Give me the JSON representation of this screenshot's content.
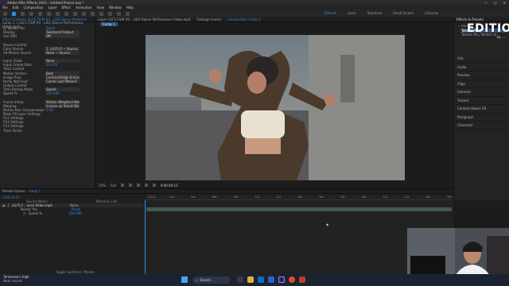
{
  "window": {
    "title": "Adobe After Effects 2023 - Untitled Project.aep *",
    "controls": [
      "—",
      "□",
      "✕"
    ]
  },
  "menu": [
    "File",
    "Edit",
    "Composition",
    "Layer",
    "Effect",
    "Animation",
    "View",
    "Window",
    "Help"
  ],
  "workspaces": [
    "Default",
    "Learn",
    "Standard",
    "Small Screen",
    "Libraries"
  ],
  "active_workspace": "Default",
  "effect_panel": {
    "tab": "Effect Controls: LILI'S FILM #2 - LISA Dance Performa",
    "header": "Comp 1 • LILI'S FILM #2 - LISA Dance Performance Video.mp4",
    "props": [
      {
        "name": "fx Twixtor Pro",
        "value": "Reset",
        "style": "blue"
      },
      {
        "name": "Display",
        "value": "Twixtored Output"
      },
      {
        "name": "Use GPU",
        "value": "Off"
      },
      {
        "name": "",
        "value": "",
        "style": "none"
      },
      {
        "name": "Source Control",
        "value": "",
        "style": "none"
      },
      {
        "name": "Color Source",
        "value": "1. LILI'S Fi ~  Source"
      },
      {
        "name": "Alt Motion Source",
        "value": "None ~  Source"
      },
      {
        "name": "",
        "value": "",
        "style": "none"
      },
      {
        "name": "Input: Fields",
        "value": "None"
      },
      {
        "name": "Input: Frame Rate",
        "value": "23.976",
        "style": "blue"
      },
      {
        "name": "Track Control",
        "value": "",
        "style": "none"
      },
      {
        "name": "Motion Vectors",
        "value": "Best"
      },
      {
        "name": "Image Prep",
        "value": "Contrast/Edge Enhance"
      },
      {
        "name": "Parity Warning?",
        "value": "Cache Last Motion?"
      },
      {
        "name": "Output Control",
        "value": "",
        "style": "none"
      },
      {
        "name": "Time Remap Mode",
        "value": "Speed"
      },
      {
        "name": "Speed %",
        "value": "100.000",
        "style": "blue"
      },
      {
        "name": "",
        "value": "",
        "style": "none"
      },
      {
        "name": "Frame Interp",
        "value": "Motion Weighted Blend"
      },
      {
        "name": "Warping",
        "value": "Inverse w/ Smart Blend"
      },
      {
        "name": "Motion Blur Compensation",
        "value": "0.00",
        "style": "blue"
      },
      {
        "name": "Mask Fill Layer Settings",
        "value": "",
        "style": "none"
      },
      {
        "name": "FG1 Settings",
        "value": "",
        "style": "none"
      },
      {
        "name": "FG2 Settings",
        "value": "",
        "style": "none"
      },
      {
        "name": "FG3 Settings",
        "value": "",
        "style": "none"
      },
      {
        "name": "Track Points",
        "value": "",
        "style": "none"
      }
    ]
  },
  "viewer": {
    "tabs": [
      "Layer  LILI'S FILM #2 - LISA Dance Performance Video.mp4",
      "Footage  (none)",
      "Composition  Comp 1"
    ],
    "subtab": "Comp 1",
    "zoom": "25%",
    "quality": "Full",
    "timecode": "0:00:04:15"
  },
  "right_panel": {
    "title": "Effects & Presets",
    "search": "twixtor",
    "results": [
      "Twixtor Pro",
      "Twixtor Pro, Vectors In"
    ],
    "items": [
      "Info",
      "Audio",
      "Preview",
      "Align",
      "Libraries",
      "Tracker",
      "Content-Aware Fill",
      "Paragraph",
      "Character"
    ]
  },
  "timeline": {
    "panel_tabs": [
      "Render Queue",
      "Comp 1"
    ],
    "timecode": "0:00:04:15",
    "columns": [
      "Source Name",
      "Parent & Link"
    ],
    "layers": [
      {
        "index": "1",
        "name": "LILI'S F... ance Video.mp4",
        "parent": "None"
      },
      {
        "index": "",
        "name": "Twixtor Pro",
        "parent": ""
      },
      {
        "index": "",
        "name": "Speed %",
        "parent": "100.000"
      }
    ],
    "ruler": [
      "0:00s",
      "02s",
      "04s",
      "06s",
      "08s",
      "10s",
      "12s",
      "14s",
      "16s",
      "18s",
      "20s",
      "22s",
      "24s",
      "26s",
      "28s"
    ],
    "reset": "Reset",
    "footer": "Toggle Switches / Modes"
  },
  "taskbar": {
    "notification": "Tomorrow's high",
    "notification_sub": "Near record",
    "search": "Search",
    "time": "",
    "colors": {
      "edge": "#0f6cbd",
      "ae": "#2a1f6b",
      "chrome": "#e04b2f",
      "files": "#e3b13c",
      "store": "#2a62c9"
    }
  },
  "logo": {
    "text": "EDITION",
    "sub": "by …"
  },
  "colors": {
    "accent": "#2d8ceb",
    "panel": "#232323",
    "bg": "#1c1c1c"
  }
}
